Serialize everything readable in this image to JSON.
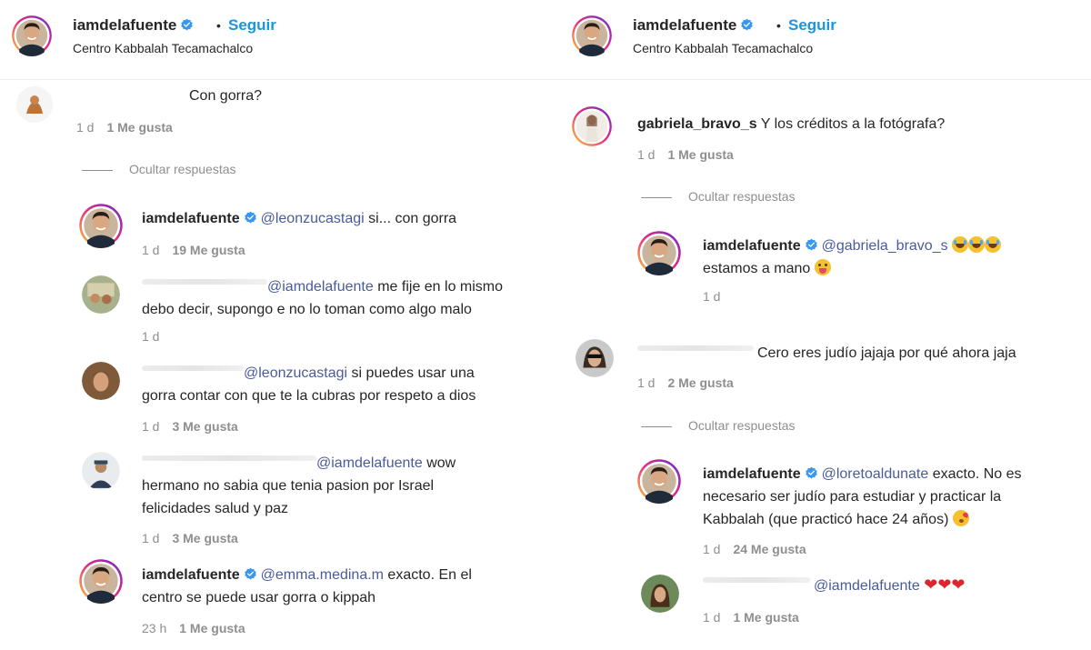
{
  "header": {
    "username": "iamdelafuente",
    "follow_label": "Seguir",
    "separator": "•",
    "location": "Centro Kabbalah Tecamachalco"
  },
  "left": {
    "comments": [
      {
        "text": "Con gorra?",
        "time": "1 d",
        "likes": "1 Me gusta"
      }
    ],
    "hide_replies": "Ocultar respuestas",
    "replies": [
      {
        "username": "iamdelafuente",
        "mention": "@leonzucastagi",
        "text": " si... con gorra",
        "time": "1 d",
        "likes": "19 Me gusta"
      },
      {
        "mention": "@iamdelafuente",
        "text1": " me fije en lo mismo",
        "text2": "debo decir, supongo e no lo toman como algo malo",
        "time": "1 d"
      },
      {
        "mention": "@leonzucastagi",
        "text1": " si puedes usar una",
        "text2": "gorra contar con que te la cubras por respeto a dios",
        "time": "1 d",
        "likes": "3 Me gusta"
      },
      {
        "mention": "@iamdelafuente",
        "text1": " wow",
        "text2": "hermano no sabia que tenia pasion por Israel",
        "text3": "felicidades salud y paz",
        "time": "1 d",
        "likes": "3 Me gusta"
      },
      {
        "username": "iamdelafuente",
        "mention": "@emma.medina.m",
        "text1": " exacto. En el",
        "text2": "centro se puede usar gorra o kippah",
        "time": "23 h",
        "likes": "1 Me gusta"
      }
    ]
  },
  "right": {
    "comment1": {
      "username": "gabriela_bravo_s",
      "text": " Y los créditos a la fotógrafa?",
      "time": "1 d",
      "likes": "1 Me gusta"
    },
    "hide_replies_1": "Ocultar respuestas",
    "reply1": {
      "username": "iamdelafuente",
      "mention": "@gabriela_bravo_s",
      "text2": "estamos a mano",
      "time": "1 d"
    },
    "comment2": {
      "text": "Cero eres judío jajaja por qué ahora jaja",
      "time": "1 d",
      "likes": "2 Me gusta"
    },
    "hide_replies_2": "Ocultar respuestas",
    "reply2": {
      "username": "iamdelafuente",
      "mention": "@loretoaldunate",
      "text1": " exacto. No es",
      "text2": "necesario ser judío para estudiar y practicar la",
      "text3": "Kabbalah (que practicó hace 24 años)",
      "time": "1 d",
      "likes": "24 Me gusta"
    },
    "reply3": {
      "mention": "@iamdelafuente",
      "time": "1 d",
      "likes": "1 Me gusta"
    }
  },
  "colors": {
    "follow": "#1b95e0",
    "mention": "#4a5b9b",
    "meta": "#8e8e8e",
    "verified": "#3897f0",
    "story_ring": "#d62976"
  },
  "icons": [
    "verified-badge-icon",
    "laughing-emoji-icon",
    "tongue-emoji-icon",
    "kiss-emoji-icon",
    "heart-emoji-icon"
  ]
}
